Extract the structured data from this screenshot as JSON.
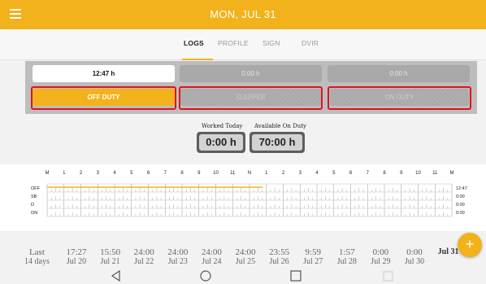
{
  "header": {
    "date": "MON, JUL 31"
  },
  "tabs": [
    {
      "label": "LOGS",
      "active": true
    },
    {
      "label": "PROFILE",
      "active": false
    },
    {
      "label": "SIGN",
      "active": false
    },
    {
      "label": "DVIR",
      "active": false
    }
  ],
  "statuses": [
    {
      "time": "12:47 h",
      "label": "OFF DUTY",
      "active": true
    },
    {
      "time": "0:00 h",
      "label": "SLEEPER",
      "active": false
    },
    {
      "time": "0:00 h",
      "label": "ON DUTY",
      "active": false
    }
  ],
  "summary": {
    "worked_label": "Worked Today",
    "worked_value": "0:00 h",
    "available_label": "Available On Duty",
    "available_value": "70:00 h"
  },
  "graph": {
    "hours": [
      "M",
      "1",
      "2",
      "3",
      "4",
      "5",
      "6",
      "7",
      "8",
      "9",
      "10",
      "11",
      "N",
      "1",
      "2",
      "3",
      "4",
      "5",
      "6",
      "7",
      "8",
      "9",
      "10",
      "11",
      "M"
    ],
    "rows": [
      {
        "label": "OFF",
        "total": "12:47"
      },
      {
        "label": "SB",
        "total": "0:00"
      },
      {
        "label": "D",
        "total": "0:00"
      },
      {
        "label": "ON",
        "total": "0:00"
      }
    ],
    "off_duty_until_hour": 12.78,
    "line_color": "#f2b21b"
  },
  "history": {
    "first_label_1": "Last",
    "first_label_2": "14 days",
    "days": [
      {
        "time": "17:27",
        "date": "Jul 20"
      },
      {
        "time": "15:50",
        "date": "Jul 21"
      },
      {
        "time": "24:00",
        "date": "Jul 22"
      },
      {
        "time": "24:00",
        "date": "Jul 23"
      },
      {
        "time": "24:00",
        "date": "Jul 24"
      },
      {
        "time": "24:00",
        "date": "Jul 25"
      },
      {
        "time": "23:55",
        "date": "Jul 26"
      },
      {
        "time": "9:59",
        "date": "Jul 27"
      },
      {
        "time": "1:57",
        "date": "Jul 28"
      },
      {
        "time": "0:00",
        "date": "Jul 29"
      },
      {
        "time": "0:00",
        "date": "Jul 30"
      },
      {
        "time": "",
        "date": "Jul 31"
      }
    ]
  },
  "fab": {
    "icon": "plus-icon",
    "label": "+"
  },
  "colors": {
    "accent": "#f2b21b",
    "highlight": "#e0141f"
  }
}
